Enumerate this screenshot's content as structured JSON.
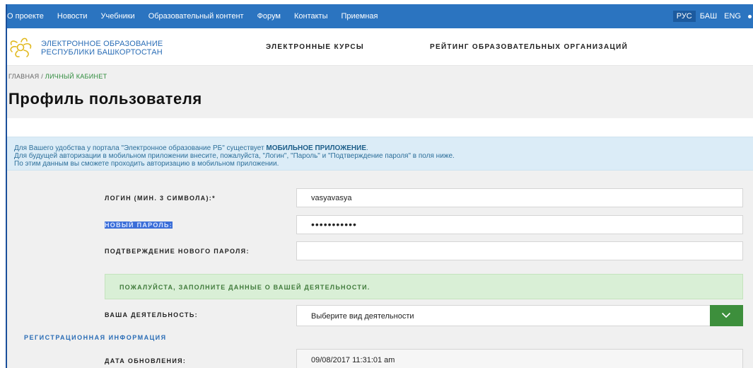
{
  "topnav": {
    "links": [
      "О проекте",
      "Новости",
      "Учебники",
      "Образовательный контент",
      "Форум",
      "Контакты",
      "Приемная"
    ],
    "lang": [
      "РУС",
      "БАШ",
      "ENG"
    ]
  },
  "brand": {
    "title_line1": "ЭЛЕКТРОННОЕ ОБРАЗОВАНИЕ",
    "title_line2": "РЕСПУБЛИКИ БАШКОРТОСТАН",
    "nav": [
      "ЭЛЕКТРОННЫЕ КУРСЫ",
      "РЕЙТИНГ ОБРАЗОВАТЕЛЬНЫХ ОРГАНИЗАЦИЙ"
    ]
  },
  "breadcrumb": {
    "home": "ГЛАВНАЯ",
    "sep": " / ",
    "current": "ЛИЧНЫЙ КАБИНЕТ"
  },
  "page_title": "Профиль пользователя",
  "info": {
    "line1_prefix": "Для Вашего удобства у портала \"Электронное образование РБ\" существует ",
    "line1_bold": "МОБИЛЬНОЕ ПРИЛОЖЕНИЕ",
    "line1_suffix": ".",
    "line2": "Для будущей авторизации в мобильном приложении внесите, пожалуйста, \"Логин\", \"Пароль\" и \"Подтверждение пароля\" в поля ниже.",
    "line3": "По этим данным вы сможете проходить авторизацию в мобильном приложении."
  },
  "form": {
    "login_label": "ЛОГИН (МИН. 3 СИМВОЛА):*",
    "login_value": "vasyavasya",
    "new_password_label": "НОВЫЙ ПАРОЛЬ:",
    "new_password_value": "•••••••••••",
    "confirm_password_label": "ПОДТВЕРЖДЕНИЕ НОВОГО ПАРОЛЯ:",
    "confirm_password_value": "",
    "notice": "ПОЖАЛУЙСТА, ЗАПОЛНИТЕ ДАННЫЕ О ВАШЕЙ ДЕЯТЕЛЬНОСТИ.",
    "activity_label": "ВАША ДЕЯТЕЛЬНОСТЬ:",
    "activity_value": "Выберите вид деятельности",
    "section_title": "РЕГИСТРАЦИОННАЯ ИНФОРМАЦИЯ",
    "updated_label": "ДАТА ОБНОВЛЕНИЯ:",
    "updated_value": "09/08/2017 11:31:01 am"
  },
  "icons": {
    "logo": "sunburst-logo-icon",
    "select_arrow": "chevron-down-icon"
  },
  "colors": {
    "topnav": "#2b74c0",
    "brand": "#2a6db6",
    "accent_green": "#3d8f3c",
    "info_bg": "#dbecf7"
  }
}
